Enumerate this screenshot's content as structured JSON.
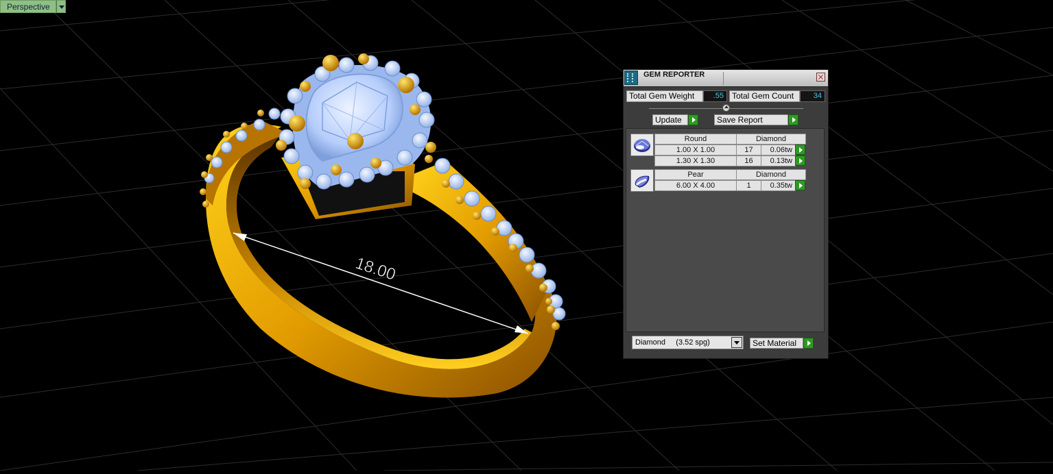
{
  "viewport": {
    "label": "Perspective",
    "dimension": "18.00",
    "colors": {
      "metal": "#e8a800",
      "gem": "#bcd6ff",
      "grid": "#2d2d2d"
    }
  },
  "gem_reporter": {
    "title": "GEM REPORTER",
    "total_gem_weight_label": "Total Gem Weight",
    "total_gem_weight": ".55",
    "total_gem_count_label": "Total Gem Count",
    "total_gem_count": "34",
    "update_label": "Update",
    "save_report_label": "Save Report",
    "groups": [
      {
        "shape": "Round",
        "material": "Diamond",
        "icon": "round-gem-icon",
        "rows": [
          {
            "size": "1.00 X 1.00",
            "count": "17",
            "weight": "0.06tw"
          },
          {
            "size": "1.30 X 1.30",
            "count": "16",
            "weight": "0.13tw"
          }
        ]
      },
      {
        "shape": "Pear",
        "material": "Diamond",
        "icon": "pear-gem-icon",
        "rows": [
          {
            "size": "6.00 X 4.00",
            "count": "1",
            "weight": "0.35tw"
          }
        ]
      }
    ],
    "material_selected": "Diamond     (3.52 spg)",
    "set_material_label": "Set Material"
  }
}
